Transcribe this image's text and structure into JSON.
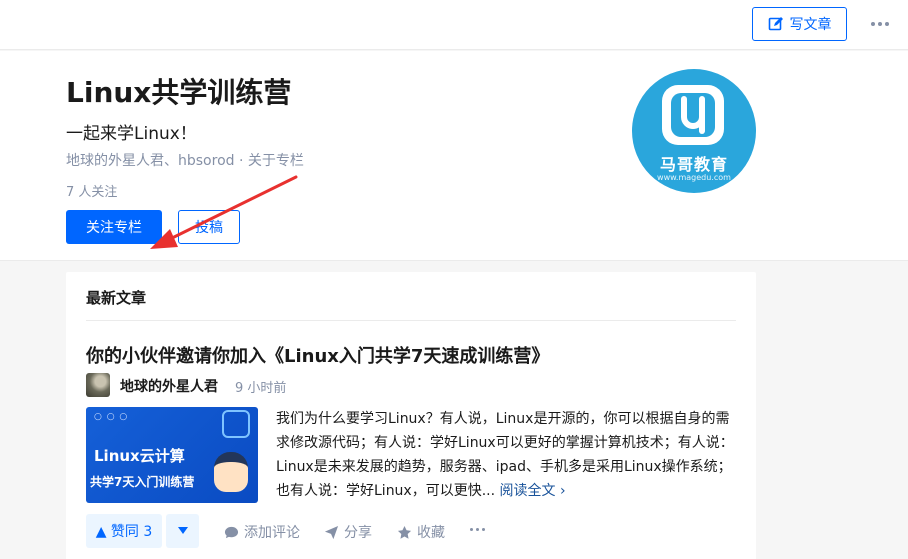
{
  "topbar": {
    "write_label": "写文章"
  },
  "column": {
    "title": "Linux共学训练营",
    "description": "一起来学Linux！",
    "authors_line": "地球的外星人君、hbsorod · 关于专栏",
    "followers": "7 人关注",
    "follow_label": "关注专栏",
    "submit_label": "投稿",
    "logo_brand": "马哥教育",
    "logo_url": "www.magedu.com"
  },
  "feed": {
    "section_title": "最新文章",
    "article": {
      "title": "你的小伙伴邀请你加入《Linux入门共学7天速成训练营》",
      "author": "地球的外星人君",
      "time": "9 小时前",
      "thumb_line1": "Linux云计算",
      "thumb_line2": "共学7天入门训练营",
      "excerpt": "我们为什么要学习Linux？有人说，Linux是开源的，你可以根据自身的需求修改源代码；有人说：学好Linux可以更好的掌握计算机技术；有人说：Linux是未来发展的趋势，服务器、ipad、手机多是采用Linux操作系统；也有人说：学好Linux，可以更快...",
      "read_more": "阅读全文 ›",
      "vote_label": "▲ 赞同 3",
      "comment_label": "添加评论",
      "share_label": "分享",
      "favorite_label": "收藏"
    }
  },
  "colors": {
    "accent": "#0066ff",
    "muted": "#8590a6",
    "annotation_arrow": "#e8312f",
    "logo_bg": "#2aa6dc"
  }
}
